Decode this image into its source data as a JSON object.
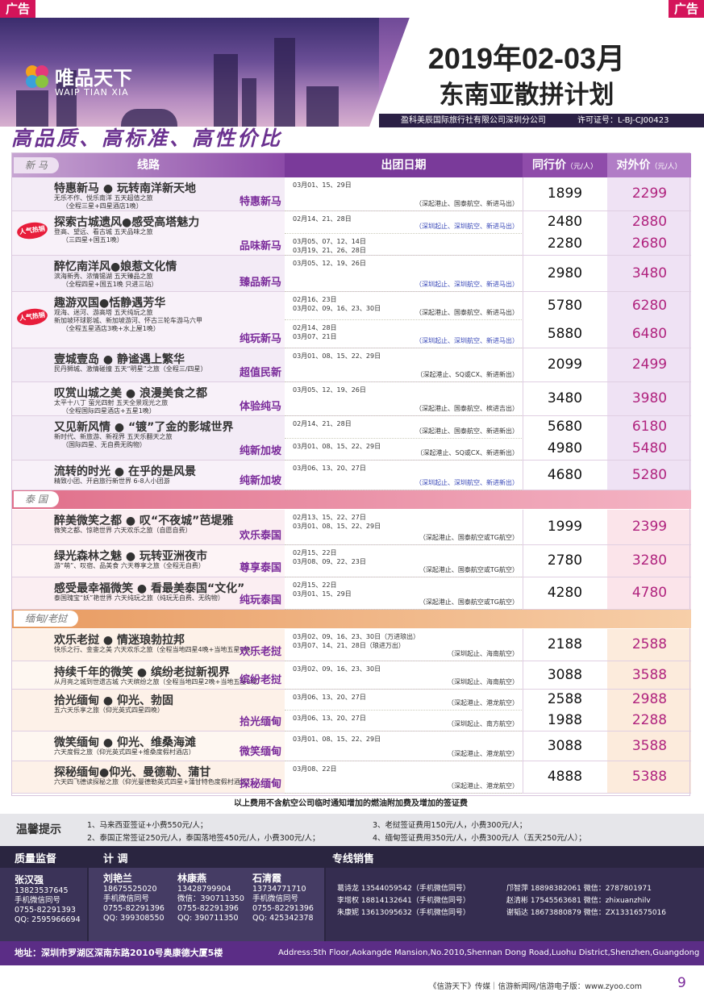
{
  "ad_left": "广告",
  "ad_right": "广告",
  "logo": {
    "name": "唯品天下",
    "en": "WAIP TIAN XIA"
  },
  "title": {
    "line1": "2019年02-03月",
    "line2": "东南亚散拼计划"
  },
  "company": "盈科美辰国际旅行社有限公司深圳分公司",
  "license": "许可证号：L-BJ-CJ00423",
  "slogan": "高品质、高标准、高性价比",
  "table_headers": {
    "route": "线路",
    "date": "出团日期",
    "trade": "同行价",
    "public": "对外价",
    "unit": "（元/人）"
  },
  "regions": {
    "xinma": "新  马",
    "taiguo": "泰  国",
    "miandian": "缅甸/老挝"
  },
  "hot_badge": "人气热销",
  "rows": [
    {
      "title": "特惠新马 ● 玩转南洋新天地",
      "sub": [
        "无乐不作、悦乐南洋 五天超值之旅",
        "（全程三星+四星酒店1晚）"
      ],
      "label": "特惠新马",
      "hot": false,
      "dates": [
        {
          "d": "03月01、15、29日",
          "a": "（深起港止、国泰航空、新进马出）",
          "t": "1899",
          "p": "2299"
        }
      ]
    },
    {
      "title": "探索古城遗风●感受高塔魅力",
      "sub": [
        "登高、望远、看古城 五天品味之旅",
        "（三四星+国五1晚）"
      ],
      "label": "品味新马",
      "hot": true,
      "dates": [
        {
          "d": "02月14、21、28日",
          "a": "（深圳起止、深圳航空、新进马出）",
          "t": "2480",
          "p": "2880"
        },
        {
          "d": "03月05、07、12、14日 / 03月19、21、26、28日",
          "a": "",
          "t": "2280",
          "p": "2680"
        }
      ]
    },
    {
      "title": "醉忆南洋风●娘惹文化情",
      "sub": [
        "滨海新秀、浓情锡湖 五天臻品之旅",
        "（全程四星+国五1晚 只进三站）"
      ],
      "label": "臻品新马",
      "hot": false,
      "dates": [
        {
          "d": "03月05、12、19、26日",
          "a": "（深圳起止、深圳航空、新进马出）",
          "t": "2980",
          "p": "3480"
        }
      ]
    },
    {
      "title": "趣游双国●恬静遇芳华",
      "sub": [
        "观海、迷河、游高塔 五天纯玩之旅",
        "新加坡环球影城、新加坡游河、怀古三轮车游马六甲",
        "（全程五星酒店3晚+水上屋1晚）"
      ],
      "label": "纯玩新马",
      "hot": true,
      "dates": [
        {
          "d": "02月16、23日 / 03月02、09、16、23、30日",
          "a": "（深起港止、国泰航空、新进马出）",
          "t": "5780",
          "p": "6280"
        },
        {
          "d": "02月14、28日 / 03月07、21日",
          "a": "（深圳起止、深圳航空、新进马出）",
          "t": "5880",
          "p": "6480"
        }
      ]
    },
    {
      "title": "壹城壹岛 ● 静谧遇上繁华",
      "sub": [
        "民丹狮城、激情碰撞 五天“明星”之旅（全程三/四星）"
      ],
      "label": "超值民新",
      "hot": false,
      "dates": [
        {
          "d": "03月01、08、15、22、29日",
          "a": "（深起港止、SQ或CX、新进新出）",
          "t": "2099",
          "p": "2499"
        }
      ]
    },
    {
      "title": "叹赏山城之美 ● 浪漫美食之都",
      "sub": [
        "太平十八丁 萤光四射 五天全景观光之旅",
        "（全程国际四星酒店+五星1晚）"
      ],
      "label": "体验纯马",
      "hot": false,
      "dates": [
        {
          "d": "03月05、12、19、26日",
          "a": "（深起港止、国泰航空、槟进吉出）",
          "t": "3480",
          "p": "3980"
        }
      ]
    },
    {
      "title": "又见新风情 ● “镀”了金的影城世界",
      "sub": [
        "新时代、新旅游、新视界 五天乐翻天之旅",
        "（国际四星、无自费无购物）"
      ],
      "label": "纯新加坡",
      "hot": false,
      "dates": [
        {
          "d": "02月14、21、28日",
          "a": "（深起港止、国泰航空、新进新出）",
          "t": "5680",
          "p": "6180"
        },
        {
          "d": "03月01、08、15、22、29日",
          "a": "（深起港止、SQ或CX、新进新出）",
          "t": "4980",
          "p": "5480"
        }
      ]
    },
    {
      "title": "流转的时光 ● 在乎的是风景",
      "sub": [
        "精致小团、开启旅行新世界 6-8人小团游"
      ],
      "label": "纯新加坡",
      "hot": false,
      "dates": [
        {
          "d": "03月06、13、20、27日",
          "a": "（深圳起止、深圳航空、新进新出）",
          "t": "4680",
          "p": "5280"
        }
      ]
    },
    {
      "title": "醉美微笑之都 ● 叹“不夜城”芭堤雅",
      "sub": [
        "微笑之都、惊艳世界 六天欢乐之旅（自愿自费）"
      ],
      "label": "欢乐泰国",
      "hot": false,
      "dates": [
        {
          "d": "02月13、15、22、27日 / 03月01、08、15、22、29日",
          "a": "（深起港止、国泰航空或TG航空）",
          "t": "1999",
          "p": "2399"
        }
      ]
    },
    {
      "title": "绿光森林之魅 ● 玩转亚洲夜市",
      "sub": [
        "游“萌”、叹宿、品美食 六天尊享之旅（全程无自费）"
      ],
      "label": "尊享泰国",
      "hot": false,
      "dates": [
        {
          "d": "02月15、22日 / 03月08、09、22、23日",
          "a": "（深起港止、国泰航空或TG航空）",
          "t": "2780",
          "p": "3280"
        }
      ]
    },
    {
      "title": "感受最幸福微笑 ● 看最美泰国“文化”",
      "sub": [
        "泰国瑰宝“妖”艳世界 六天纯玩之旅（纯玩无自费、无购物）"
      ],
      "label": "纯玩泰国",
      "hot": false,
      "dates": [
        {
          "d": "02月15、22日 / 03月01、15、29日",
          "a": "（深起港止、国泰航空或TG航空）",
          "t": "4280",
          "p": "4780"
        }
      ]
    },
    {
      "title": "欢乐老挝 ●  情迷琅勃拉邦",
      "sub": [
        "快乐之行、金銮之美 六天欢乐之旅（全程当地四星4晚+当地五星1晚）"
      ],
      "label": "欢乐老挝",
      "hot": false,
      "dates": [
        {
          "d": "03月02、09、16、23、30日（万进琅出） / 03月07、14、21、28日（琅进万出）",
          "a": "（深圳起止、海南航空）",
          "t": "2188",
          "p": "2588"
        }
      ]
    },
    {
      "title": "持续千年的微笑 ● 缤纷老挝新视界",
      "sub": [
        "从月亮之城到世遗古城 六天缤纷之旅（全程当地四星2晚+当地五星3晚）"
      ],
      "label": "缤纷老挝",
      "hot": false,
      "dates": [
        {
          "d": "03月02、09、16、23、30日",
          "a": "（深圳起止、海南航空）",
          "t": "3088",
          "p": "3588"
        }
      ]
    },
    {
      "title": "拾光缅甸 ● 仰光、勃固",
      "sub": [
        "五六天乐享之旅（仰光英式四星四晚）"
      ],
      "label": "拾光缅甸",
      "hot": false,
      "dates": [
        {
          "d": "03月06、13、20、27日",
          "a": "（深起港止、港龙航空）",
          "t": "2588",
          "p": "2988"
        },
        {
          "d": "03月06、13、20、27日",
          "a": "（深圳起止、南方航空）",
          "t": "1988",
          "p": "2288"
        }
      ]
    },
    {
      "title": "微笑缅甸 ● 仰光、维桑海滩",
      "sub": [
        "六天度假之旅（仰光英式四星+维桑度假村酒店）"
      ],
      "label": "微笑缅甸",
      "hot": false,
      "dates": [
        {
          "d": "03月01、08、15、22、29日",
          "a": "（深起港止、港龙航空）",
          "t": "3088",
          "p": "3588"
        }
      ]
    },
    {
      "title": "探秘缅甸●仰光、曼德勒、蒲甘",
      "sub": [
        "六天四飞德读探秘之旅（仰光曼德勒英式四星+蒲甘特色度假村酒店）"
      ],
      "label": "探秘缅甸",
      "hot": false,
      "dates": [
        {
          "d": "03月08、22日",
          "a": "（深起港止、港龙航空）",
          "t": "4888",
          "p": "5388"
        }
      ]
    }
  ],
  "note": "以上费用不含航空公司临时通知增加的燃油附加费及增加的签证费",
  "tips": {
    "label": "温馨提示",
    "items": [
      "1、马来西亚签证+小费550元/人；",
      "2、泰国正常签证250元/人，泰国落地签450元/人，小费300元/人；",
      "3、老挝签证费用150元/人，小费300元/人；",
      "4、缅甸签证费用350元/人，小费300元/人（五天250元/人）；"
    ]
  },
  "footer": {
    "h_quality": "质量监督",
    "h_ops": "计  调",
    "h_sales": "专线销售",
    "quality": {
      "name": "张汉强",
      "lines": [
        "13823537645",
        "手机微信同号",
        "0755-82291393",
        "QQ: 2595966694"
      ]
    },
    "ops": [
      {
        "name": "刘艳兰",
        "lines": [
          "18675525020",
          "手机微信同号",
          "0755-82291396",
          "QQ: 399308550"
        ]
      },
      {
        "name": "林康燕",
        "lines": [
          "13428799904",
          "微信：390711350",
          "0755-82291396",
          "QQ: 390711350"
        ]
      },
      {
        "name": "石清霞",
        "lines": [
          "13734771710",
          "手机微信同号",
          "0755-82291396",
          "QQ: 425342378"
        ]
      }
    ],
    "sales_left": [
      "葛诗龙  13544059542（手机微信同号）",
      "李增权  18814132641（手机微信同号）",
      "朱康妮  13613095632（手机微信同号）"
    ],
    "sales_right": [
      "邝智萍  18898382061  微信：2787801971",
      "赵清彬  17545563681  微信：zhixuanzhilv",
      "谢韬达  18673880879  微信：ZX13316575016"
    ]
  },
  "address": "地址：深圳市罗湖区深南东路2010号奥康德大厦5楼",
  "address_en": "Address:5th Floor,Aokangde Mansion,No.2010,Shennan Dong Road,Luohu District,Shenzhen,Guangdong",
  "bottom_text": "《信游天下》传媒｜信游新闻网/信游电子版：www.zyoo.com",
  "page_number": "9",
  "colors": {
    "purple": "#7a2a9a",
    "pink_price": "#b0237e",
    "footer": "#2a2540",
    "region_xinma": "#a775bd",
    "region_taiguo": "#e06f8a",
    "region_miandian": "#e89a60"
  }
}
